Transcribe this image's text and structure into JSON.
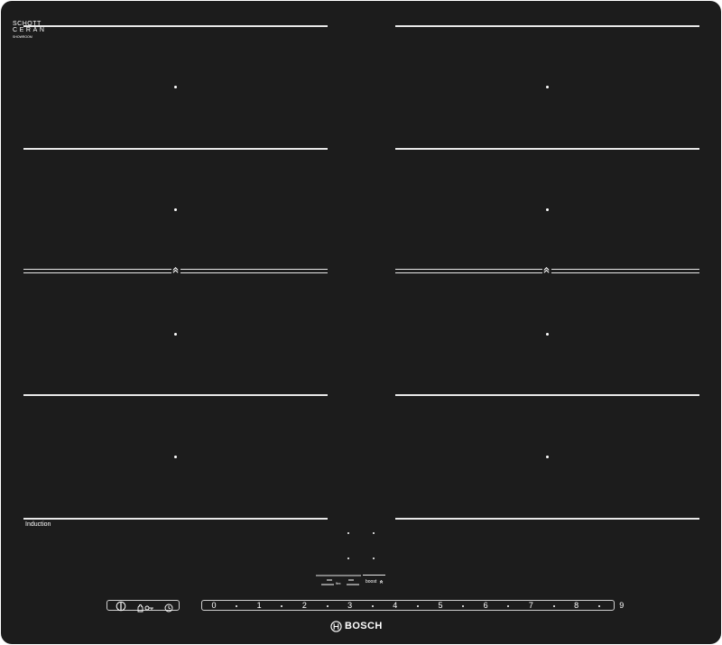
{
  "logo": {
    "line1": "SCHOTT",
    "line2": "CERAN",
    "line3": "SHOWROOM"
  },
  "zone_label": "Induction",
  "flex_label": "flex",
  "boost_label": "boost",
  "power_levels": [
    "0",
    "1",
    "2",
    "3",
    "4",
    "5",
    "6",
    "7",
    "8",
    "9"
  ],
  "brand": "BOSCH",
  "icons": {
    "power": "power-icon",
    "child_lock": "child-lock-icon",
    "key": "key-icon",
    "timer": "timer-icon",
    "boost": "boost-chevron-icon",
    "flex": "flex-zone-icon",
    "brand": "bosch-logo-icon"
  },
  "colors": {
    "surface": "#1c1c1c",
    "markings": "#e8e8e8"
  }
}
